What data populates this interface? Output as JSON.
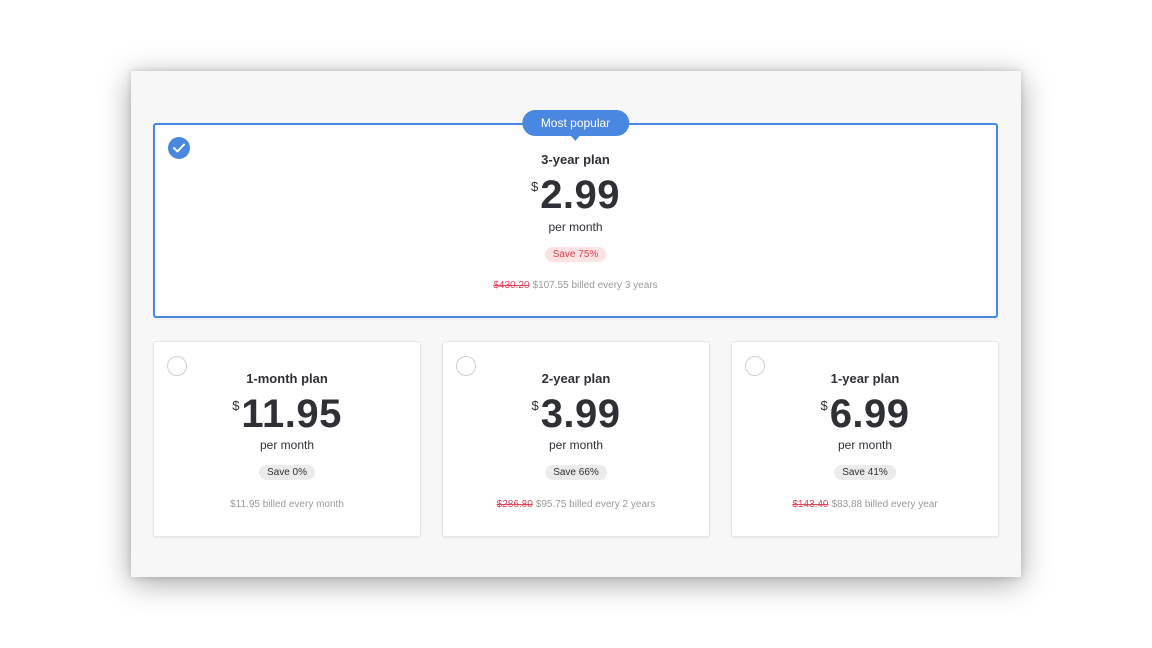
{
  "featured": {
    "badge": "Most popular",
    "name": "3-year plan",
    "currency": "$",
    "price": "2.99",
    "per": "per month",
    "save": "Save 75%",
    "old_price": "$430.20",
    "billing": "$107.55 billed every 3 years",
    "selected": true
  },
  "plans": [
    {
      "name": "1-month plan",
      "currency": "$",
      "price": "11.95",
      "per": "per month",
      "save": "Save 0%",
      "old_price": "",
      "billing": "$11.95 billed every month"
    },
    {
      "name": "2-year plan",
      "currency": "$",
      "price": "3.99",
      "per": "per month",
      "save": "Save 66%",
      "old_price": "$286.80",
      "billing": "$95.75 billed every 2 years"
    },
    {
      "name": "1-year plan",
      "currency": "$",
      "price": "6.99",
      "per": "per month",
      "save": "Save 41%",
      "old_price": "$143.40",
      "billing": "$83.88 billed every year"
    }
  ],
  "colors": {
    "accent": "#4a87e0",
    "strike": "#e0465a",
    "save_pink_bg": "#fde2e4"
  },
  "icons": {
    "selected": "checkmark-icon",
    "unselected": "radio-empty-icon"
  }
}
